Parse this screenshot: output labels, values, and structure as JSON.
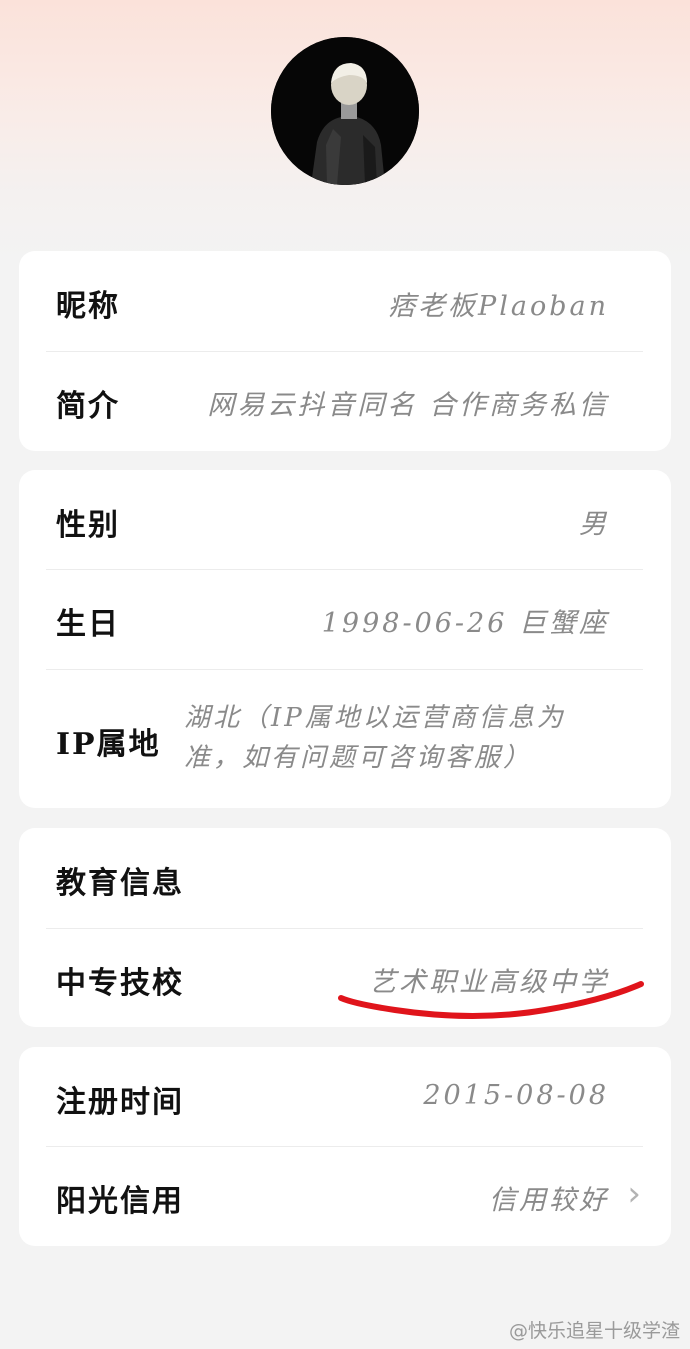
{
  "profile": {
    "nickname_label": "昵称",
    "nickname": "痞老板Plaoban",
    "bio_label": "简介",
    "bio": "网易云抖音同名 合作商务私信"
  },
  "details": {
    "gender_label": "性别",
    "gender": "男",
    "birthday_label": "生日",
    "birthday": "1998-06-26 巨蟹座",
    "ip_label": "IP属地",
    "ip_line1": "湖北（IP属地以运营商信息为",
    "ip_line2": "准，如有问题可咨询客服）"
  },
  "education": {
    "section_label": "教育信息",
    "school_label": "中专技校",
    "school": "艺术职业高级中学",
    "annotation_color": "#e0141b"
  },
  "account": {
    "register_label": "注册时间",
    "register_date": "2015-08-08",
    "credit_label": "阳光信用",
    "credit_value": "信用较好",
    "chevron": "chevron-right-icon"
  },
  "watermark": "@快乐追星十级学渣"
}
